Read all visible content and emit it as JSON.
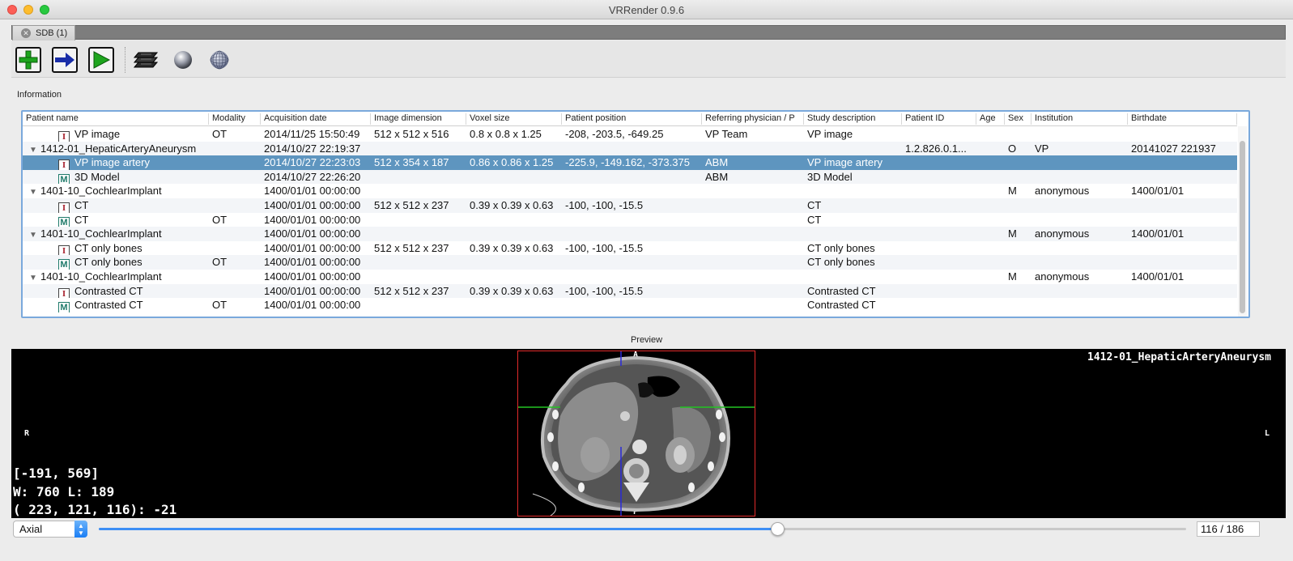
{
  "window": {
    "title": "VRRender 0.9.6"
  },
  "tabs": [
    {
      "label": "SDB (1)"
    }
  ],
  "toolbar": {
    "buttons": [
      {
        "icon": "add-icon",
        "color": "#1ea51e"
      },
      {
        "icon": "arrow-right-icon",
        "color": "#1a2ea8"
      },
      {
        "icon": "play-icon",
        "color": "#1ea51e"
      }
    ],
    "icons": [
      "slices-stack-icon",
      "sphere-icon",
      "mesh-sphere-icon"
    ]
  },
  "information": {
    "label": "Information",
    "columns": [
      "Patient name",
      "Modality",
      "Acquisition date",
      "Image dimension",
      "Voxel size",
      "Patient position",
      "Referring physician / P",
      "Study description",
      "Patient ID",
      "Age",
      "Sex",
      "Institution",
      "Birthdate"
    ],
    "rows": [
      {
        "type": "I",
        "level": 1,
        "cells": [
          "VP image",
          "OT",
          "2014/11/25 15:50:49",
          "512 x 512 x 516",
          "0.8 x 0.8 x 1.25",
          "-208, -203.5, -649.25",
          "VP Team",
          "VP image",
          "",
          "",
          "",
          "",
          ""
        ]
      },
      {
        "type": "patient",
        "level": 0,
        "cells": [
          "1412-01_HepaticArteryAneurysm",
          "",
          "2014/10/27 22:19:37",
          "",
          "",
          "",
          "",
          "",
          "1.2.826.0.1...",
          "",
          "O",
          "VP",
          "20141027 221937"
        ]
      },
      {
        "type": "I",
        "level": 1,
        "selected": true,
        "cells": [
          "VP image artery",
          "",
          "2014/10/27 22:23:03",
          "512 x 354 x 187",
          "0.86 x 0.86 x 1.25",
          "-225.9, -149.162, -373.375",
          "ABM",
          "VP image artery",
          "",
          "",
          "",
          "",
          ""
        ]
      },
      {
        "type": "M",
        "level": 1,
        "cells": [
          "3D Model",
          "",
          "2014/10/27 22:26:20",
          "",
          "",
          "",
          "ABM",
          "3D Model",
          "",
          "",
          "",
          "",
          ""
        ]
      },
      {
        "type": "patient",
        "level": 0,
        "cells": [
          "1401-10_CochlearImplant",
          "",
          "1400/01/01 00:00:00",
          "",
          "",
          "",
          "",
          "",
          "",
          "",
          "M",
          "anonymous",
          "1400/01/01"
        ]
      },
      {
        "type": "I",
        "level": 1,
        "cells": [
          "CT",
          "",
          "1400/01/01 00:00:00",
          "512 x 512 x 237",
          "0.39 x 0.39 x 0.63",
          "-100, -100, -15.5",
          "",
          "CT",
          "",
          "",
          "",
          "",
          ""
        ]
      },
      {
        "type": "M",
        "level": 1,
        "cells": [
          "CT",
          "OT",
          "1400/01/01 00:00:00",
          "",
          "",
          "",
          "",
          "CT",
          "",
          "",
          "",
          "",
          ""
        ]
      },
      {
        "type": "patient",
        "level": 0,
        "cells": [
          "1401-10_CochlearImplant",
          "",
          "1400/01/01 00:00:00",
          "",
          "",
          "",
          "",
          "",
          "",
          "",
          "M",
          "anonymous",
          "1400/01/01"
        ]
      },
      {
        "type": "I",
        "level": 1,
        "cells": [
          "CT only bones",
          "",
          "1400/01/01 00:00:00",
          "512 x 512 x 237",
          "0.39 x 0.39 x 0.63",
          "-100, -100, -15.5",
          "",
          "CT only bones",
          "",
          "",
          "",
          "",
          ""
        ]
      },
      {
        "type": "M",
        "level": 1,
        "cells": [
          "CT only bones",
          "OT",
          "1400/01/01 00:00:00",
          "",
          "",
          "",
          "",
          "CT only bones",
          "",
          "",
          "",
          "",
          ""
        ]
      },
      {
        "type": "patient",
        "level": 0,
        "cells": [
          "1401-10_CochlearImplant",
          "",
          "1400/01/01 00:00:00",
          "",
          "",
          "",
          "",
          "",
          "",
          "",
          "M",
          "anonymous",
          "1400/01/01"
        ]
      },
      {
        "type": "I",
        "level": 1,
        "cells": [
          "Contrasted CT",
          "",
          "1400/01/01 00:00:00",
          "512 x 512 x 237",
          "0.39 x 0.39 x 0.63",
          "-100, -100, -15.5",
          "",
          "Contrasted CT",
          "",
          "",
          "",
          "",
          ""
        ]
      },
      {
        "type": "M",
        "level": 1,
        "cells": [
          "Contrasted CT",
          "OT",
          "1400/01/01 00:00:00",
          "",
          "",
          "",
          "",
          "Contrasted CT",
          "",
          "",
          "",
          "",
          ""
        ]
      }
    ]
  },
  "preview": {
    "label": "Preview",
    "patient_name": "1412-01_HepaticArteryAneurysm",
    "orientation": {
      "anterior": "A",
      "posterior": "P",
      "right": "R",
      "left": "L"
    },
    "cursor": "[-191, 569]",
    "window_level": "W: 760 L: 189",
    "voxel_value": "( 223, 121, 116): -21"
  },
  "controls": {
    "view_mode": "Axial",
    "slice_current": 116,
    "slice_total": 186,
    "slice_label": "116 / 186"
  },
  "colors": {
    "selection": "#5e95bf",
    "frame": "#7aa9dc",
    "crosshair_green": "#22c422",
    "crosshair_blue": "#2a2ad8",
    "scan_border": "#e22a2a",
    "slider_accent": "#3d8ef5"
  }
}
